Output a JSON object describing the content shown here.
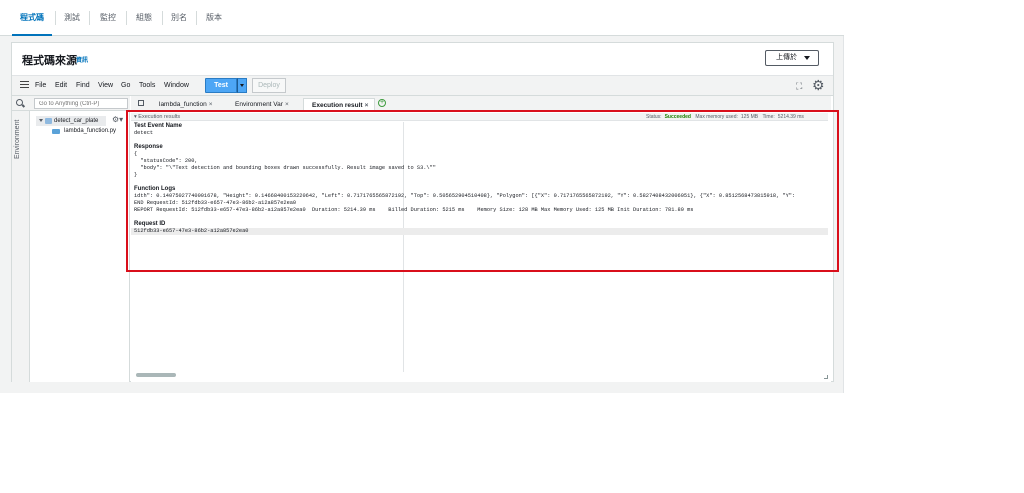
{
  "tabs": [
    "程式碼",
    "測試",
    "監控",
    "組態",
    "別名",
    "版本"
  ],
  "panel": {
    "title": "程式碼來源",
    "info": "資訊",
    "upload_label": "上傳於"
  },
  "toolbar": {
    "menus": [
      "File",
      "Edit",
      "Find",
      "View",
      "Go",
      "Tools",
      "Window"
    ],
    "test_label": "Test",
    "deploy_label": "Deploy"
  },
  "search": {
    "placeholder": "Go to Anything (Ctrl-P)"
  },
  "sidebar": {
    "environment_label": "Environment",
    "folder": "detect_car_plate",
    "file": "lambda_function.py"
  },
  "editor_tabs": [
    {
      "label": "lambda_function"
    },
    {
      "label": "Environment Var"
    },
    {
      "label": "Execution result"
    }
  ],
  "results": {
    "toggle_label": "Execution results",
    "status_label": "Status:",
    "status_value": "Succeeded",
    "memory_label": "Max memory used:",
    "memory_value": "125 MB",
    "time_label": "Time:",
    "time_value": "5214.39 ms",
    "test_event_heading": "Test Event Name",
    "test_event_value": "detect",
    "response_heading": "Response",
    "response_lines": [
      "{",
      "  \"statusCode\": 200,",
      "  \"body\": \"\\\"Text detection and bounding boxes drawn successfully. Result image saved to S3.\\\"\"",
      "}"
    ],
    "logs_heading": "Function Logs",
    "log_lines": [
      "idth\": 0.14075027740001678, \"Height\": 0.14668400153220642, \"Left\": 0.7171765565872192, \"Top\": 0.505652904510408}, \"Polygon\": [{\"X\": 0.7171765565872192, \"Y\": 0.5827408432006051}, {\"X\": 0.8512568473815918, \"Y\":",
      "END RequestId: 512fdb33-e657-47e3-86b2-a12a857e2ea0",
      "REPORT RequestId: 512fdb33-e657-47e3-86b2-a12a857e2ea0  Duration: 5214.39 ms    Billed Duration: 5215 ms    Memory Size: 128 MB Max Memory Used: 125 MB Init Duration: 781.80 ms"
    ],
    "request_heading": "Request ID",
    "request_value": "512fdb33-e657-47e3-86b2-a12a857e2ea0"
  },
  "colors": {
    "accent": "#0073bb",
    "test_button": "#4da6f5",
    "success": "#1d8102",
    "highlight": "#d90f1b"
  }
}
